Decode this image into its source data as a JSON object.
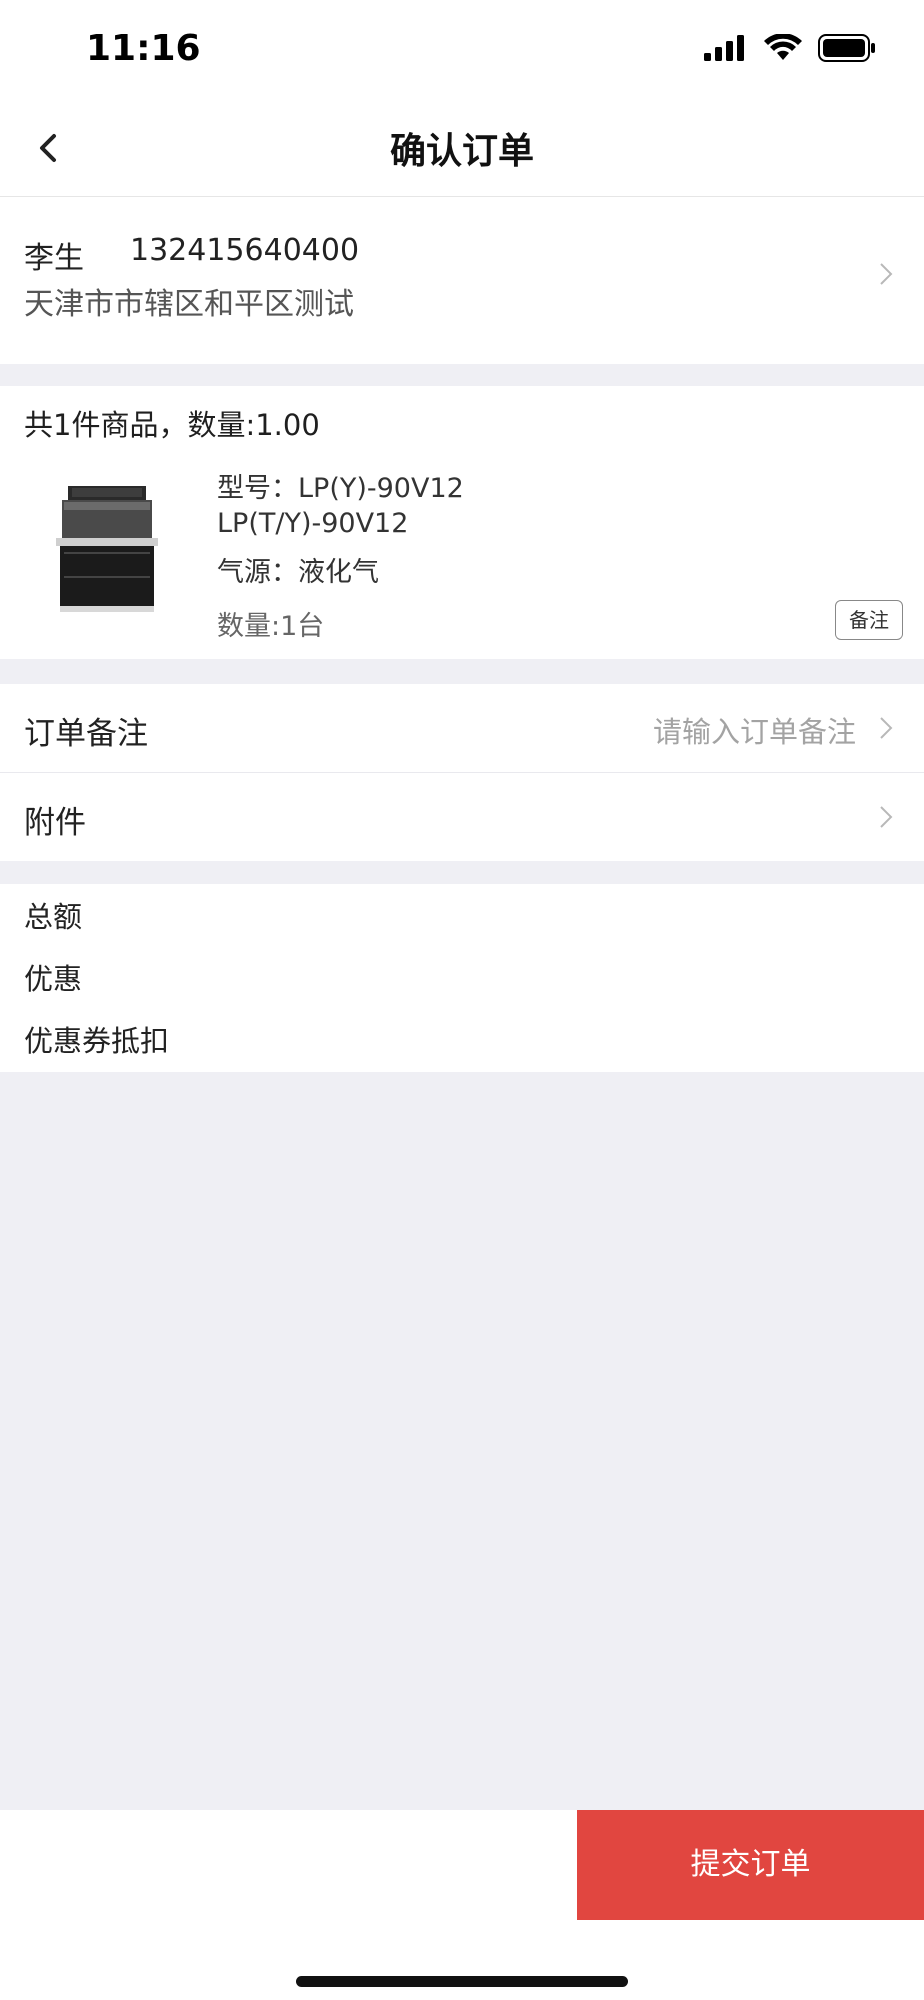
{
  "status_bar": {
    "time": "11:16"
  },
  "nav": {
    "title": "确认订单"
  },
  "address": {
    "name": "李生",
    "phone": "132415640400",
    "detail": "天津市市辖区和平区测试"
  },
  "goods": {
    "summary": "共1件商品，数量:1.00",
    "item": {
      "spec_line1": "型号：LP(Y)-90V12",
      "spec_line2": "LP(T/Y)-90V12",
      "spec_line3": "气源：液化气",
      "quantity": "数量:1台",
      "remark_button": "备注"
    }
  },
  "order_note": {
    "label": "订单备注",
    "placeholder": "请输入订单备注"
  },
  "attachment": {
    "label": "附件"
  },
  "totals": {
    "total_label": "总额",
    "discount_label": "优惠",
    "coupon_label": "优惠券抵扣"
  },
  "submit": {
    "label": "提交订单"
  },
  "colors": {
    "accent": "#e14640",
    "background": "#efeff4"
  }
}
